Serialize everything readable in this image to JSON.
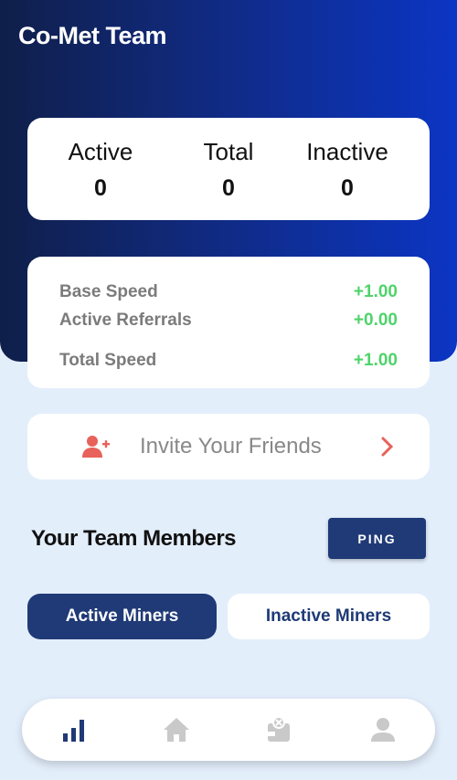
{
  "header": {
    "title": "Co-Met Team"
  },
  "stats": [
    {
      "label": "Active",
      "value": "0"
    },
    {
      "label": "Total",
      "value": "0"
    },
    {
      "label": "Inactive",
      "value": "0"
    }
  ],
  "speed": {
    "rows": [
      {
        "label": "Base Speed",
        "value": "+1.00"
      },
      {
        "label": "Active Referrals",
        "value": "+0.00"
      },
      {
        "label": "Total Speed",
        "value": "+1.00"
      }
    ]
  },
  "invite": {
    "label": "Invite Your Friends",
    "icon": "add-user-icon"
  },
  "team": {
    "title": "Your Team Members",
    "ping_label": "PING",
    "tabs": [
      {
        "label": "Active Miners",
        "selected": true
      },
      {
        "label": "Inactive Miners",
        "selected": false
      }
    ]
  },
  "bottom_nav": {
    "items": [
      {
        "icon": "bar-chart-icon",
        "active": true
      },
      {
        "icon": "home-icon",
        "active": false
      },
      {
        "icon": "wallet-icon",
        "active": false
      },
      {
        "icon": "person-icon",
        "active": false
      }
    ]
  },
  "colors": {
    "primary": "#1f3a76",
    "accent_green": "#4fd36a",
    "invite_red": "#e8615a",
    "background": "#e3eefb"
  }
}
